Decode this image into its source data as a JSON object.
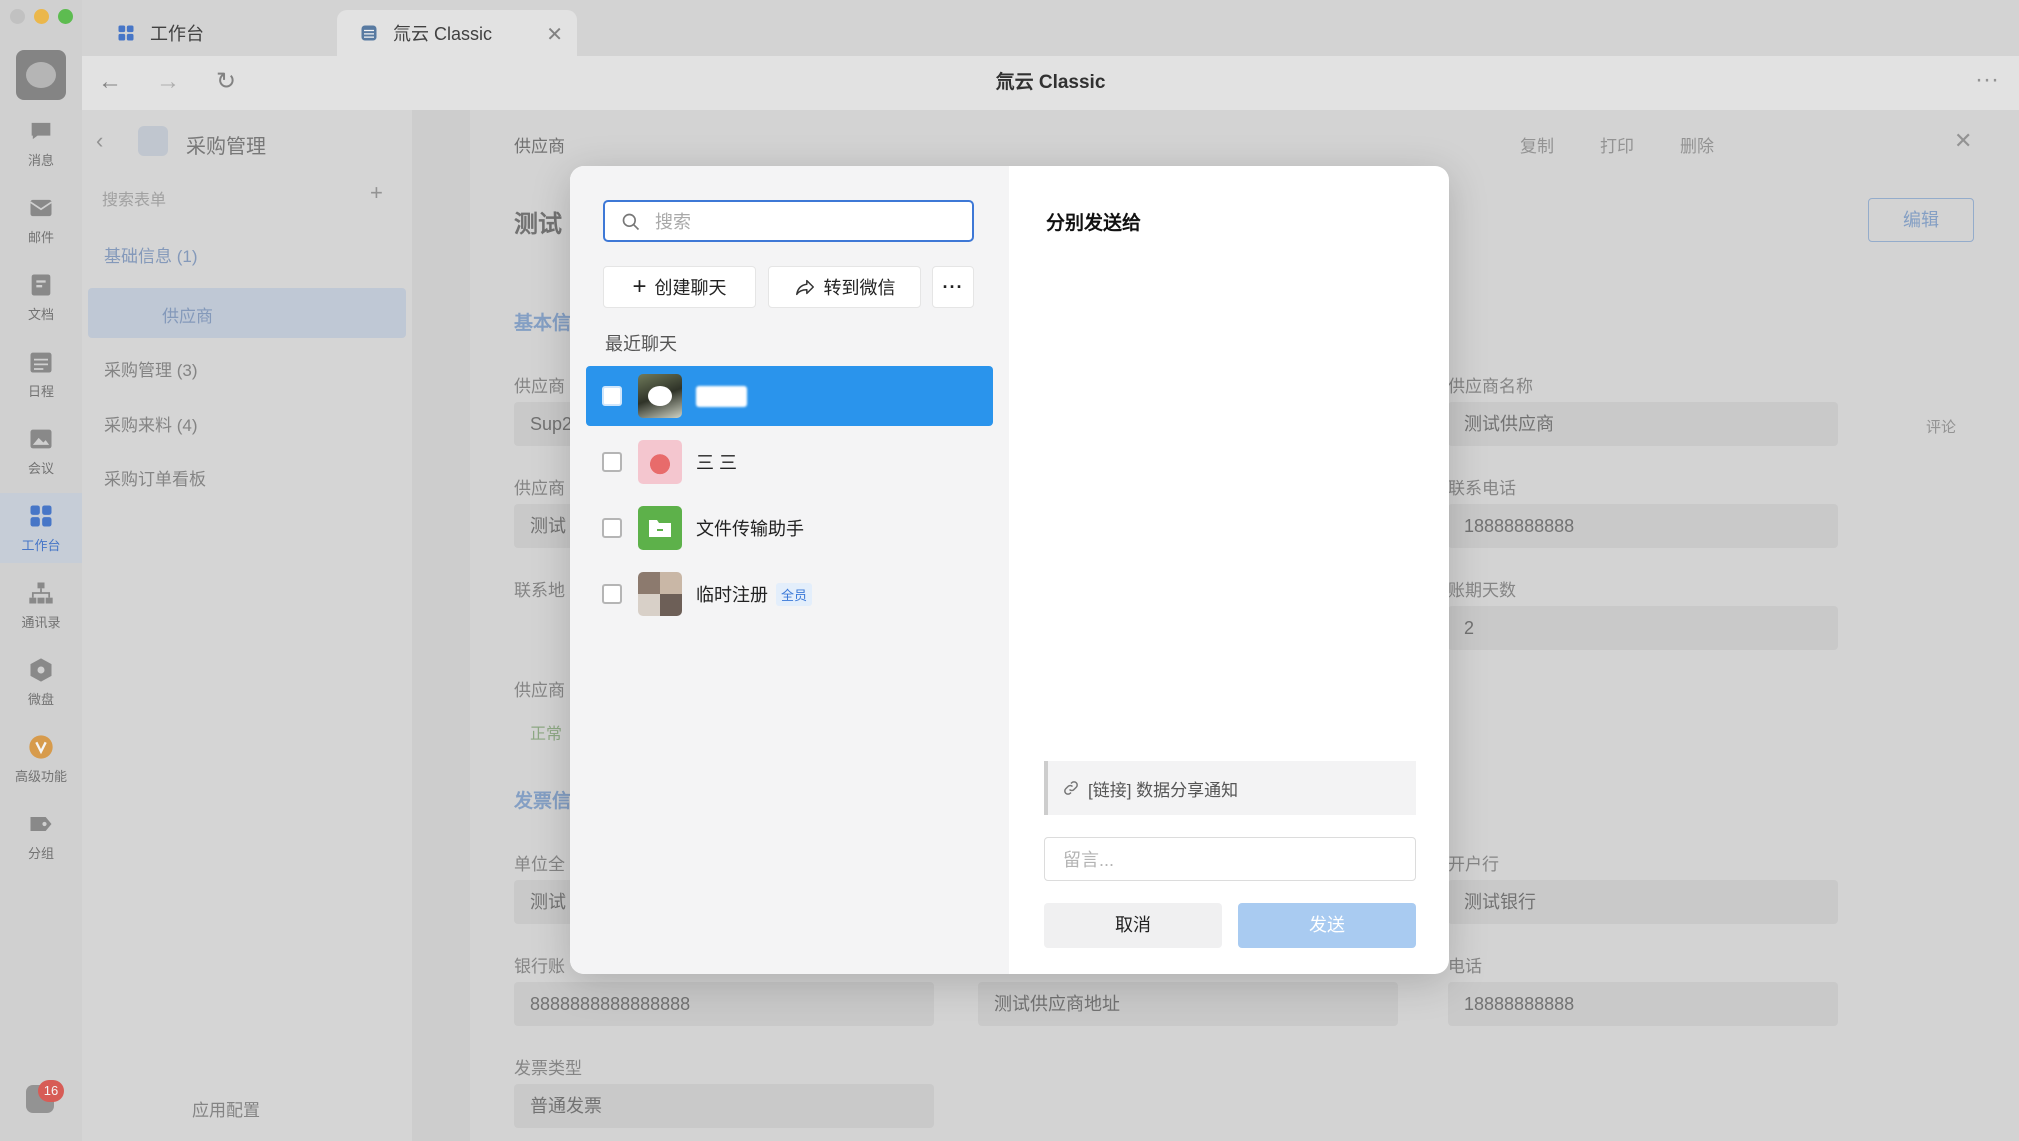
{
  "window": {
    "title": "氚云 Classic",
    "tabs": [
      {
        "label": "工作台",
        "icon": "grid-icon"
      },
      {
        "label": "氚云 Classic",
        "icon": "app-icon"
      }
    ]
  },
  "rail": {
    "items": [
      {
        "label": "消息",
        "icon": "message-icon"
      },
      {
        "label": "邮件",
        "icon": "mail-icon"
      },
      {
        "label": "文档",
        "icon": "doc-icon"
      },
      {
        "label": "日程",
        "icon": "calendar-icon"
      },
      {
        "label": "会议",
        "icon": "meeting-icon"
      },
      {
        "label": "工作台",
        "icon": "grid-icon"
      },
      {
        "label": "通讯录",
        "icon": "contacts-icon"
      },
      {
        "label": "微盘",
        "icon": "drive-icon"
      },
      {
        "label": "高级功能",
        "icon": "advanced-icon"
      },
      {
        "label": "分组",
        "icon": "group-icon"
      }
    ],
    "notification_count": "16"
  },
  "sidebar": {
    "title": "采购管理",
    "search_placeholder": "搜索表单",
    "groups": [
      {
        "label": "基础信息 (1)"
      },
      {
        "label": "供应商"
      },
      {
        "label": "采购管理 (3)"
      },
      {
        "label": "采购来料 (4)"
      },
      {
        "label": "采购订单看板"
      }
    ],
    "footer": "应用配置"
  },
  "panel": {
    "header": "供应商",
    "record_title": "测试",
    "actions": {
      "copy": "复制",
      "print": "打印",
      "delete": "删除",
      "edit": "编辑"
    },
    "comment": "评论",
    "sections": {
      "basic": "基本信",
      "invoice": "发票信"
    },
    "fields": {
      "supplier_code_label": "供应商",
      "supplier_code": "Sup2",
      "supplier_name_label": "供应商名称",
      "supplier_name": "测试供应商",
      "supplier_contact_label": "供应商",
      "supplier_contact": "测试",
      "phone_label": "联系电话",
      "phone": "18888888888",
      "address_label": "联系地",
      "term_label": "账期天数",
      "term": "2",
      "status_label": "供应商",
      "status": "正常",
      "unit_label": "单位全",
      "unit": "测试",
      "bank_label": "开户行",
      "bank": "测试银行",
      "account_label": "银行账",
      "account": "8888888888888888",
      "address2": "测试供应商地址",
      "phone2_label": "电话",
      "phone2": "18888888888",
      "invoice_type_label": "发票类型",
      "invoice_type": "普通发票"
    }
  },
  "dialog": {
    "search_placeholder": "搜索",
    "create_chat": "创建聊天",
    "forward_wechat": "转到微信",
    "more": "···",
    "recent_label": "最近聊天",
    "chats": [
      {
        "name": "████",
        "selected": true
      },
      {
        "name": "三 三",
        "selected": false
      },
      {
        "name": "文件传输助手",
        "selected": false
      },
      {
        "name": "临时注册",
        "badge": "全员",
        "selected": false
      }
    ],
    "send_to_label": "分别发送给",
    "link_text": "[链接] 数据分享通知",
    "message_placeholder": "留言...",
    "cancel": "取消",
    "send": "发送"
  }
}
